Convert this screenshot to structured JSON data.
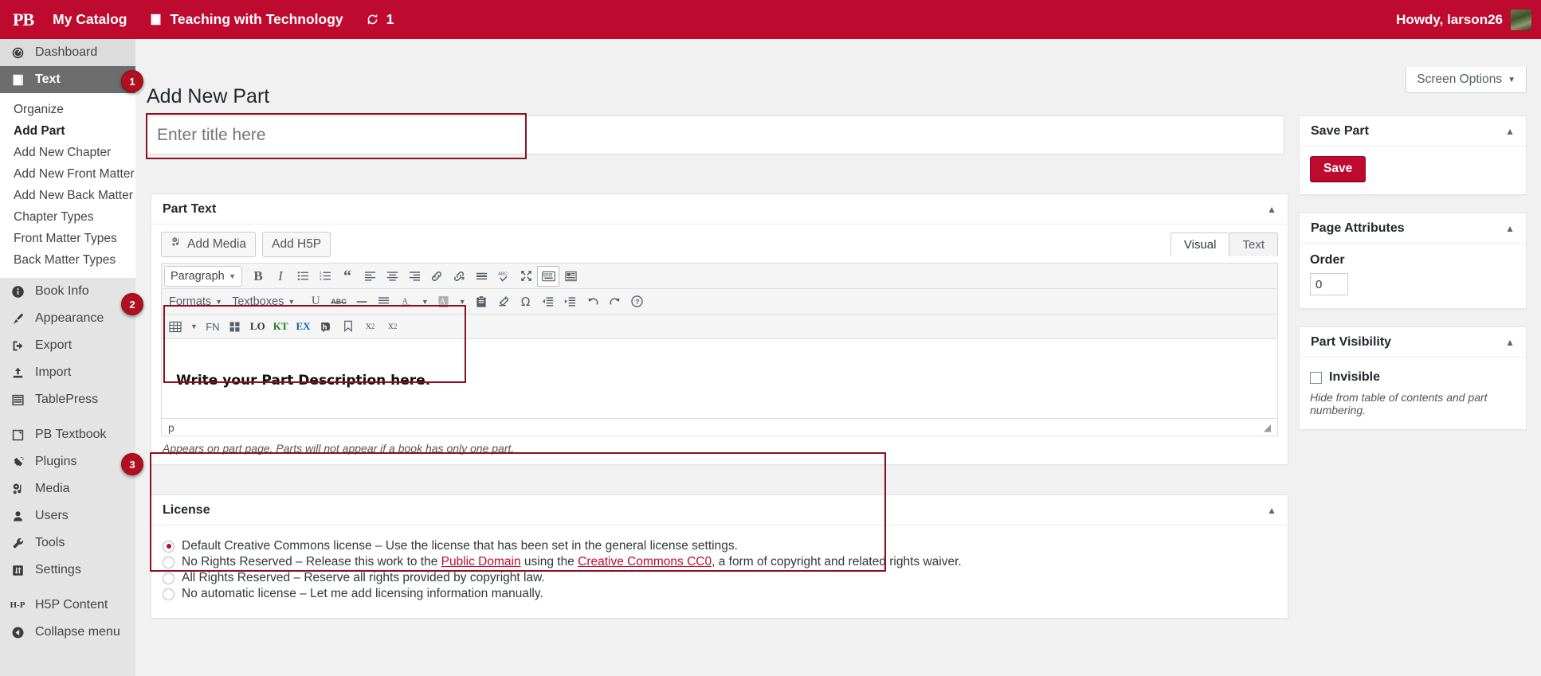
{
  "adminbar": {
    "logo": "PB",
    "items": [
      {
        "label": "My Catalog",
        "icon": "none"
      },
      {
        "label": "Teaching with Technology",
        "icon": "book-icon"
      },
      {
        "label": "1",
        "icon": "refresh-icon"
      }
    ],
    "howdy": "Howdy, larson26"
  },
  "sidebar": {
    "items": [
      {
        "label": "Dashboard",
        "icon": "dashboard-icon",
        "state": "normal"
      },
      {
        "label": "Text",
        "icon": "book-icon",
        "state": "current"
      },
      {
        "label": "Book Info",
        "icon": "info-icon",
        "state": "normal"
      },
      {
        "label": "Appearance",
        "icon": "brush-icon",
        "state": "normal"
      },
      {
        "label": "Export",
        "icon": "export-icon",
        "state": "normal"
      },
      {
        "label": "Import",
        "icon": "import-icon",
        "state": "normal"
      },
      {
        "label": "TablePress",
        "icon": "table-icon",
        "state": "normal"
      },
      {
        "label": "PB Textbook",
        "icon": "textbook-icon",
        "state": "normal"
      },
      {
        "label": "Plugins",
        "icon": "plug-icon",
        "state": "normal"
      },
      {
        "label": "Media",
        "icon": "media-icon",
        "state": "normal"
      },
      {
        "label": "Users",
        "icon": "user-icon",
        "state": "normal"
      },
      {
        "label": "Tools",
        "icon": "wrench-icon",
        "state": "normal"
      },
      {
        "label": "Settings",
        "icon": "settings-icon",
        "state": "normal"
      },
      {
        "label": "H5P Content",
        "icon": "h5p-icon",
        "state": "normal"
      },
      {
        "label": "Collapse menu",
        "icon": "collapse-icon",
        "state": "normal"
      }
    ],
    "submenu": [
      {
        "label": "Organize",
        "active": false
      },
      {
        "label": "Add Part",
        "active": true
      },
      {
        "label": "Add New Chapter",
        "active": false
      },
      {
        "label": "Add New Front Matter",
        "active": false
      },
      {
        "label": "Add New Back Matter",
        "active": false
      },
      {
        "label": "Chapter Types",
        "active": false
      },
      {
        "label": "Front Matter Types",
        "active": false
      },
      {
        "label": "Back Matter Types",
        "active": false
      }
    ]
  },
  "annotations": [
    {
      "number": "1"
    },
    {
      "number": "2"
    },
    {
      "number": "3"
    }
  ],
  "main": {
    "screen_options": "Screen Options",
    "page_title": "Add New Part",
    "title_placeholder": "Enter title here",
    "title_value": ""
  },
  "editor": {
    "panel_title": "Part Text",
    "add_media": "Add Media",
    "add_h5p": "Add H5P",
    "tab_visual": "Visual",
    "tab_text": "Text",
    "paragraph_select": "Paragraph",
    "formats_label": "Formats",
    "textboxes_label": "Textboxes",
    "content_text": "Write your Part Description here.",
    "path": "p",
    "note": "Appears on part page. Parts will not appear if a book has only one part.",
    "row1_buttons": [
      {
        "name": "bold-icon",
        "label": "B"
      },
      {
        "name": "italic-icon",
        "label": "I"
      },
      {
        "name": "bulleted-list-icon",
        "label": ""
      },
      {
        "name": "numbered-list-icon",
        "label": ""
      },
      {
        "name": "blockquote-icon",
        "label": "“"
      },
      {
        "name": "align-left-icon",
        "label": ""
      },
      {
        "name": "align-center-icon",
        "label": ""
      },
      {
        "name": "align-right-icon",
        "label": ""
      },
      {
        "name": "link-icon",
        "label": ""
      },
      {
        "name": "unlink-icon",
        "label": ""
      },
      {
        "name": "read-more-icon",
        "label": ""
      },
      {
        "name": "spellcheck-icon",
        "label": "ABC"
      },
      {
        "name": "fullscreen-icon",
        "label": ""
      },
      {
        "name": "toolbar-toggle-icon",
        "label": ""
      },
      {
        "name": "anchor-block-icon",
        "label": ""
      }
    ],
    "row2_buttons": [
      {
        "name": "underline-icon",
        "label": "U"
      },
      {
        "name": "strikethrough-icon",
        "label": "ABC"
      },
      {
        "name": "horizontal-rule-icon",
        "label": "—"
      },
      {
        "name": "justify-icon",
        "label": ""
      },
      {
        "name": "text-color-icon",
        "label": "A"
      },
      {
        "name": "background-color-icon",
        "label": "A"
      },
      {
        "name": "paste-as-text-icon",
        "label": ""
      },
      {
        "name": "clear-formatting-icon",
        "label": ""
      },
      {
        "name": "special-character-icon",
        "label": "Ω"
      },
      {
        "name": "outdent-icon",
        "label": ""
      },
      {
        "name": "indent-icon",
        "label": ""
      },
      {
        "name": "undo-icon",
        "label": ""
      },
      {
        "name": "redo-icon",
        "label": ""
      },
      {
        "name": "help-icon",
        "label": "?"
      }
    ],
    "row3_buttons": [
      {
        "name": "table-icon",
        "label": ""
      },
      {
        "name": "footnote-icon",
        "label": "FN"
      },
      {
        "name": "glossary-icon",
        "label": ""
      },
      {
        "name": "latex-lo-icon",
        "label": "LO"
      },
      {
        "name": "katex-icon",
        "label": "KT"
      },
      {
        "name": "equation-ex-icon",
        "label": "EX"
      },
      {
        "name": "hypothesis-icon",
        "label": ""
      },
      {
        "name": "anchor-icon",
        "label": ""
      },
      {
        "name": "superscript-icon",
        "label": "x²"
      },
      {
        "name": "subscript-icon",
        "label": "x₂"
      }
    ]
  },
  "license": {
    "panel_title": "License",
    "options": [
      {
        "selected": true,
        "pre": "Default Creative Commons license – Use the license that has been set in the general license settings.",
        "link1": "",
        "mid": "",
        "link2": "",
        "post": ""
      },
      {
        "selected": false,
        "pre": "No Rights Reserved – Release this work to the ",
        "link1": "Public Domain",
        "mid": " using the ",
        "link2": "Creative Commons CC0",
        "post": ", a form of copyright and related rights waiver."
      },
      {
        "selected": false,
        "pre": "All Rights Reserved – Reserve all rights provided by copyright law.",
        "link1": "",
        "mid": "",
        "link2": "",
        "post": ""
      },
      {
        "selected": false,
        "pre": "No automatic license – Let me add licensing information manually.",
        "link1": "",
        "mid": "",
        "link2": "",
        "post": ""
      }
    ]
  },
  "right": {
    "save_panel_title": "Save Part",
    "save_button": "Save",
    "attributes_panel_title": "Page Attributes",
    "order_label": "Order",
    "order_value": "0",
    "visibility_panel_title": "Part Visibility",
    "invisible_label": "Invisible",
    "invisible_hint": "Hide from table of contents and part numbering."
  },
  "colors": {
    "brand": "#bf0a30",
    "annotation": "#b01020",
    "highlight_border": "#8b1020",
    "sidebar_bg": "#e4e4e4",
    "current_item": "#6d6d6d"
  }
}
